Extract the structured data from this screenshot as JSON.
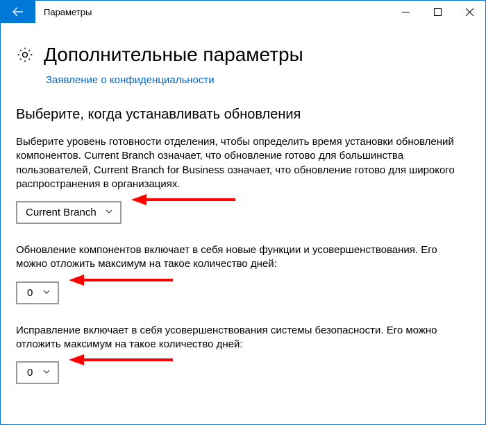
{
  "titlebar": {
    "app_title": "Параметры"
  },
  "header": {
    "page_title": "Дополнительные параметры"
  },
  "link": {
    "privacy": "Заявление о конфиденциальности"
  },
  "section": {
    "heading": "Выберите, когда устанавливать обновления",
    "readiness_text": "Выберите уровень готовности отделения, чтобы определить время установки обновлений компонентов. Current Branch означает, что обновление готово для большинства пользователей, Current Branch for Business означает, что обновление готово для широкого распространения в организациях.",
    "branch_value": "Current Branch",
    "feature_defer_text": "Обновление компонентов включает в себя новые функции и усовершенствования. Его можно отложить максимум на такое количество дней:",
    "feature_defer_value": "0",
    "quality_defer_text": "Исправление включает в себя усовершенствования системы безопасности. Его можно отложить максимум на такое количество дней:",
    "quality_defer_value": "0"
  }
}
